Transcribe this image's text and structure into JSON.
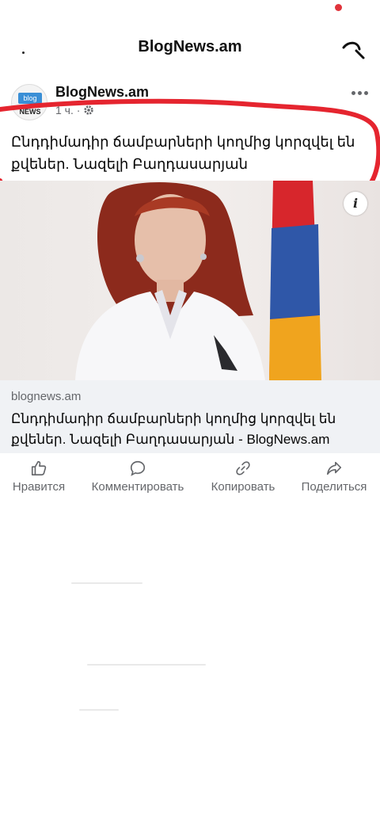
{
  "app": {
    "title": "BlogNews.am"
  },
  "post": {
    "page_name": "BlogNews.am",
    "avatar": {
      "chip": "blog",
      "word": "NEWS"
    },
    "time": "1 ч. ·",
    "privacy_icon": "gear-icon",
    "text": "Ընդդիմադիր ճամբարների կողմից կորզվել են քվեներ. Նազելի Բաղդասարյան",
    "more_icon": "more-dots-icon"
  },
  "photo": {
    "info_glyph": "i"
  },
  "link": {
    "domain": "blognews.am",
    "title": "Ընդդիմադիր ճամբարների կողմից կորզվել են քվեներ. Նազելի Բաղդասարյան - BlogNews.am"
  },
  "actions": [
    {
      "label": "Нравится",
      "icon": "thumbs-up-icon"
    },
    {
      "label": "Комментировать",
      "icon": "comment-icon"
    },
    {
      "label": "Копировать",
      "icon": "link-icon"
    },
    {
      "label": "Поделиться",
      "icon": "share-icon"
    }
  ],
  "colors": {
    "annotation": "#e5252f",
    "status_dot": "#e0333b",
    "link_card_bg": "#f0f2f5",
    "secondary_text": "#65676b"
  }
}
